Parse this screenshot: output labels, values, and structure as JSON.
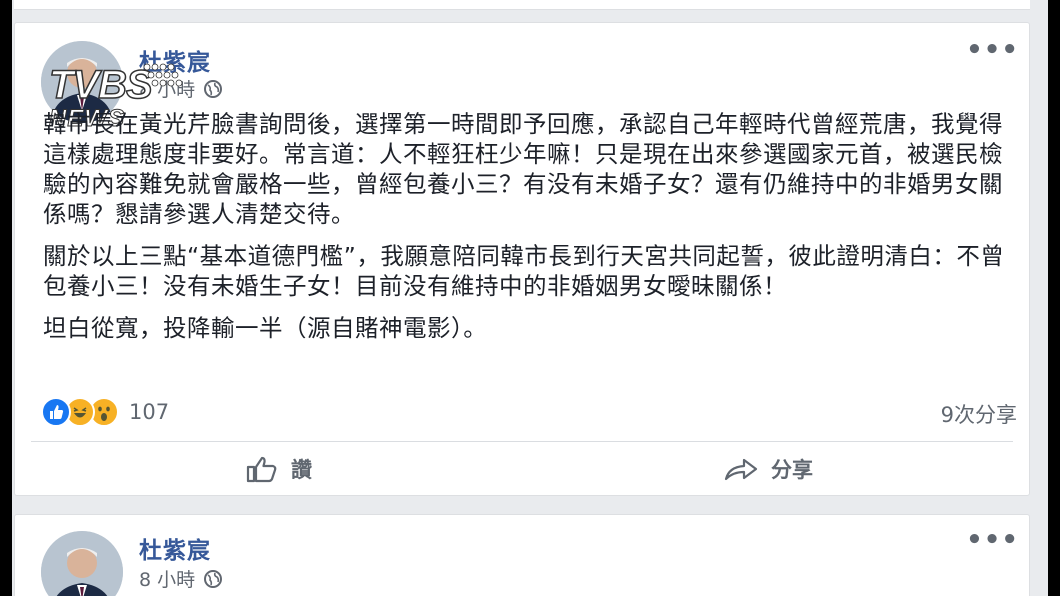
{
  "watermark": {
    "brand": "TVBS",
    "sub": "NEWS"
  },
  "post": {
    "author": "杜紫宸",
    "time": "8 小時",
    "paragraphs": [
      "韓市長在黃光芹臉書詢問後，選擇第一時間即予回應，承認自己年輕時代曾經荒唐，我覺得這樣處理態度非要好。常言道：人不輕狂枉少年嘛！只是現在出來參選國家元首，被選民檢驗的內容難免就會嚴格一些，曾經包養小三？有没有未婚子女？還有仍維持中的非婚男女關係嗎？懇請參選人清楚交待。",
      "關於以上三點“基本道德門檻”，我願意陪同韓市長到行天宮共同起誓，彼此證明清白：不曾包養小三！没有未婚生子女！目前没有維持中的非婚姻男女曖昧關係！",
      "坦白從寬，投降輸一半（源自賭神電影）。"
    ],
    "reaction_icons": [
      "like-icon",
      "haha-icon",
      "wow-icon"
    ],
    "reaction_count": "107",
    "shares": "9次分享",
    "like_label": "讚",
    "share_label": "分享"
  },
  "next_post": {
    "author": "杜紫宸",
    "time": "8 小時"
  },
  "colors": {
    "author": "#365899",
    "like_blue": "#1877f2",
    "emoji_yellow": "#f7b125",
    "meta_gray": "#616770"
  }
}
